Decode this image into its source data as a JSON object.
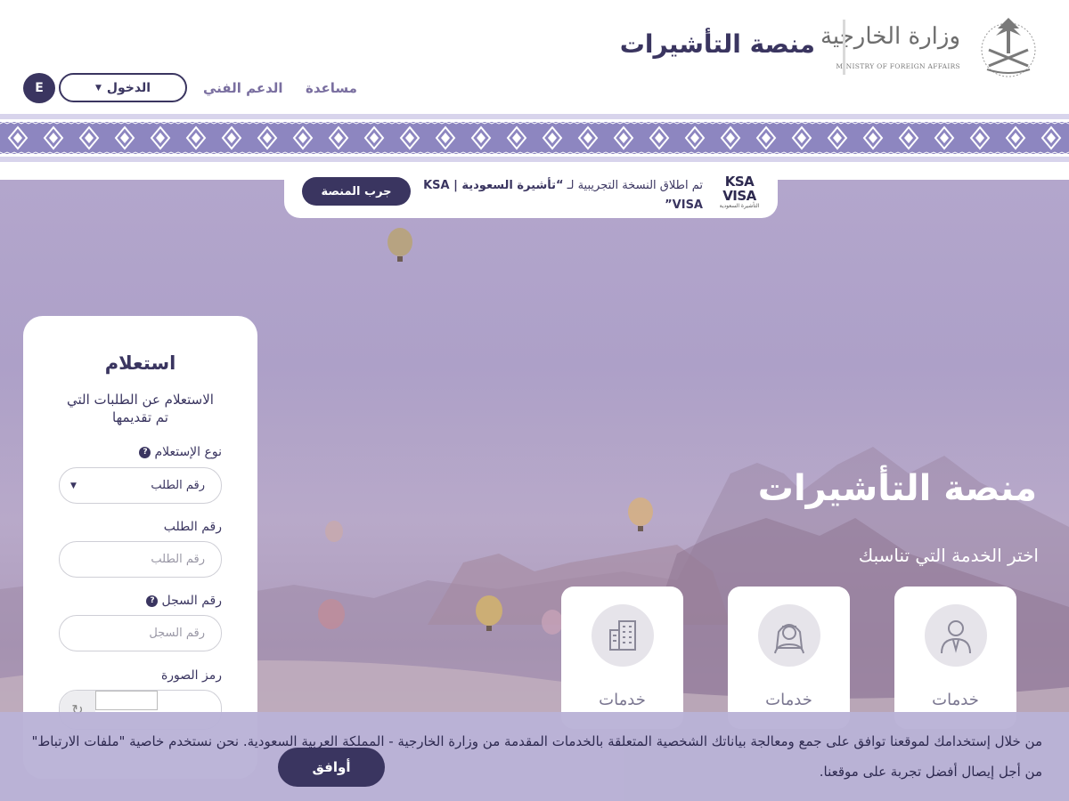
{
  "header": {
    "ministry_ar": "وزارة الخارجية",
    "ministry_en": "MINISTRY OF FOREIGN AFFAIRS",
    "site_title": "منصة التأشيرات",
    "nav": {
      "help": "مساعدة",
      "support": "الدعم الفني",
      "login": "الدخول",
      "lang": "E"
    }
  },
  "announcement": {
    "logo_l1": "KSA",
    "logo_l2": "VISA",
    "logo_sub": "التأشيرة السعودية",
    "text_prefix": "تم اطلاق النسخة التجريبية لـ ",
    "text_bold": "“تأشيرة السعودية | KSA VISA”",
    "button": "جرب المنصة"
  },
  "hero": {
    "title": "منصة التأشيرات",
    "subtitle": "اختر الخدمة التي تناسبك",
    "services": [
      {
        "label": "خدمات",
        "icon": "individual-icon"
      },
      {
        "label": "خدمات",
        "icon": "saudi-man-icon"
      },
      {
        "label": "خدمات",
        "icon": "building-icon"
      }
    ]
  },
  "inquiry": {
    "title": "استعلام",
    "description": "الاستعلام عن الطلبات التي تم تقديمها",
    "type_label": "نوع الإستعلام",
    "type_value": "رقم الطلب",
    "request_label": "رقم الطلب",
    "request_placeholder": "رقم الطلب",
    "registry_label": "رقم السجل",
    "registry_placeholder": "رقم السجل",
    "captcha_label": "رمز الصورة"
  },
  "cookie": {
    "text": "من خلال إستخدامك لموقعنا توافق على جمع ومعالجة بياناتك الشخصية المتعلقة بالخدمات المقدمة من وزارة الخارجية - المملكة العربية السعودية. نحن نستخدم خاصية \"ملفات الارتباط\" من أجل إيصال أفضل تجربة على موقعنا.",
    "button": "أوافق"
  },
  "colors": {
    "primary": "#3a3560",
    "accent": "#7a6fa0",
    "band": "#8d86c0"
  }
}
